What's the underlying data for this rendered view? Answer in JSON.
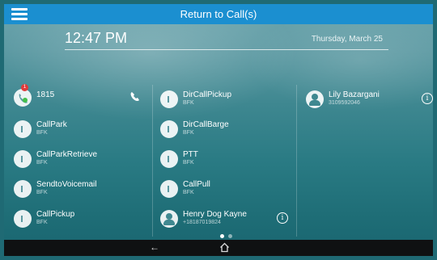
{
  "header": {
    "title": "Return to Call(s)"
  },
  "status": {
    "time": "12:47 PM",
    "date": "Thursday, March 25"
  },
  "line": {
    "number": "1815",
    "badge_count": "1"
  },
  "column1": [
    {
      "name": "CallPark",
      "sub": "BFK"
    },
    {
      "name": "CallParkRetrieve",
      "sub": "BFK"
    },
    {
      "name": "SendtoVoicemail",
      "sub": "BFK"
    },
    {
      "name": "CallPickup",
      "sub": "BFK"
    }
  ],
  "column2": [
    {
      "name": "DirCallPickup",
      "sub": "BFK"
    },
    {
      "name": "DirCallBarge",
      "sub": "BFK"
    },
    {
      "name": "PTT",
      "sub": "BFK"
    },
    {
      "name": "CallPull",
      "sub": "BFK"
    },
    {
      "name": "Henry Dog Kayne",
      "sub": "+18187019824"
    }
  ],
  "column3": [
    {
      "name": "Lily Bazargani",
      "sub": "3109592046"
    }
  ],
  "nav": {
    "back_glyph": "←"
  },
  "icons": [
    "menu-icon",
    "phone-icon",
    "key-icon",
    "contact-icon",
    "info-icon",
    "back-icon",
    "home-icon"
  ],
  "colors": {
    "header_bg": "#1b8fd0",
    "badge": "#e03a3a",
    "online": "#44c04a"
  },
  "pager": {
    "pages": 2,
    "current": 1
  }
}
